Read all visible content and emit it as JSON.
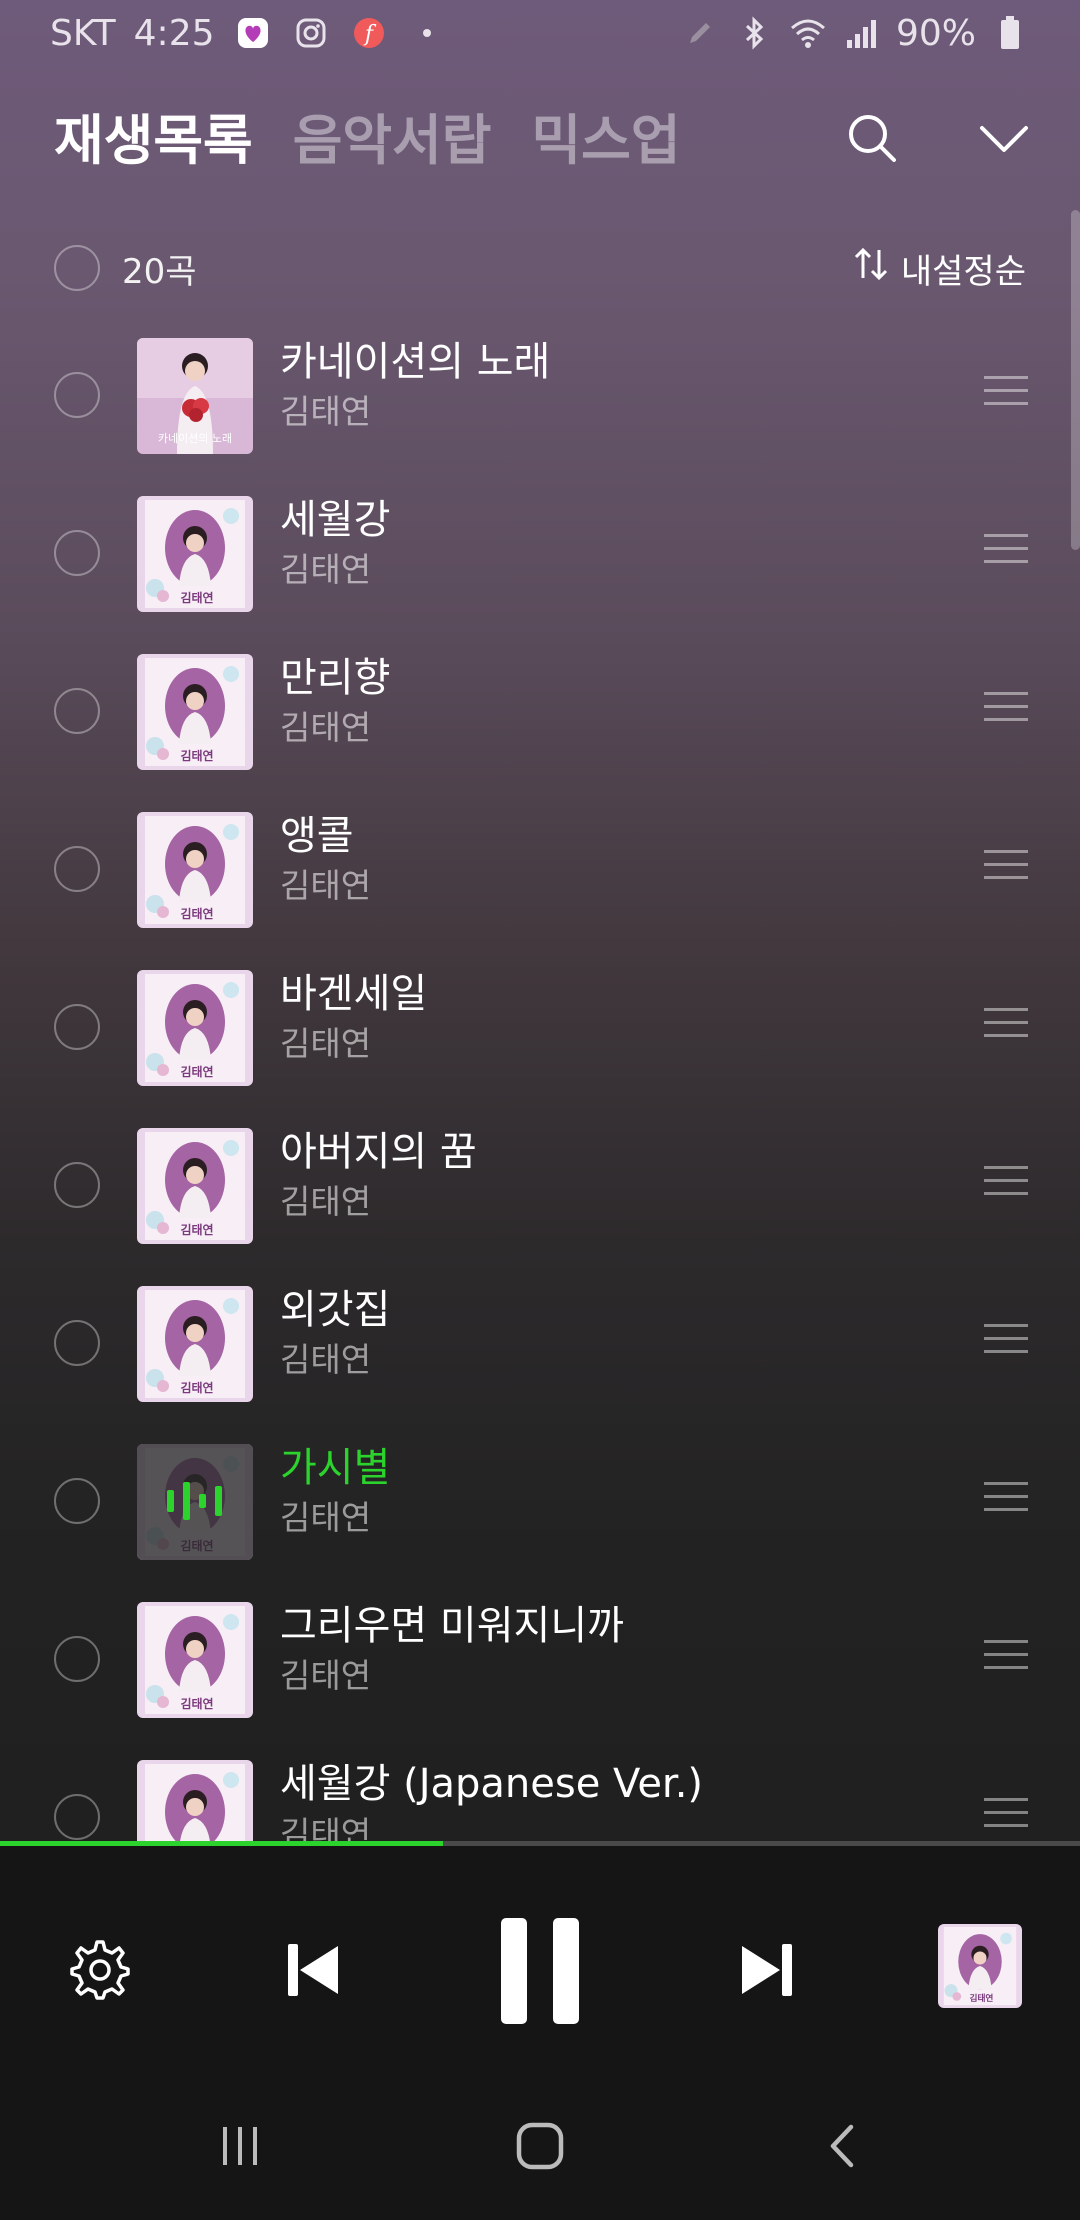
{
  "status": {
    "carrier": "SKT",
    "time": "4:25",
    "battery": "90%",
    "left_icons": [
      "heart-app-icon",
      "instagram-icon",
      "flo-app-icon",
      "dot-icon"
    ],
    "right_icons": [
      "pen-icon",
      "bluetooth-icon",
      "wifi-icon",
      "signal-icon",
      "battery-icon"
    ]
  },
  "header": {
    "tabs": [
      {
        "label": "재생목록",
        "active": true
      },
      {
        "label": "음악서랍",
        "active": false
      },
      {
        "label": "믹스업",
        "active": false
      }
    ],
    "search_icon": "search-icon",
    "collapse_icon": "chevron-down-icon"
  },
  "list_bar": {
    "count": "20곡",
    "sort_label": "내설정순",
    "sort_icon": "sort-arrows-icon"
  },
  "tracks": [
    {
      "title": "카네이션의 노래",
      "artist": "김태연",
      "cover": "carnation",
      "playing": false
    },
    {
      "title": "세월강",
      "artist": "김태연",
      "cover": "album",
      "playing": false
    },
    {
      "title": "만리향",
      "artist": "김태연",
      "cover": "album",
      "playing": false
    },
    {
      "title": "앵콜",
      "artist": "김태연",
      "cover": "album",
      "playing": false
    },
    {
      "title": "바겐세일",
      "artist": "김태연",
      "cover": "album",
      "playing": false
    },
    {
      "title": "아버지의 꿈",
      "artist": "김태연",
      "cover": "album",
      "playing": false
    },
    {
      "title": "외갓집",
      "artist": "김태연",
      "cover": "album",
      "playing": false
    },
    {
      "title": "가시별",
      "artist": "김태연",
      "cover": "album",
      "playing": true
    },
    {
      "title": "그리우면 미워지니까",
      "artist": "김태연",
      "cover": "album",
      "playing": false
    },
    {
      "title": "세월강 (Japanese Ver.)",
      "artist": "김태연",
      "cover": "album",
      "playing": false
    }
  ],
  "cover_text": {
    "carnation": "카네이션의 노래",
    "album": "김태연"
  },
  "player": {
    "progress": 0.41,
    "icons": [
      "settings-icon",
      "previous-icon",
      "pause-icon",
      "next-icon",
      "now-playing-cover"
    ]
  },
  "colors": {
    "accent": "#2cd32c",
    "bar_bg": "#151515"
  }
}
